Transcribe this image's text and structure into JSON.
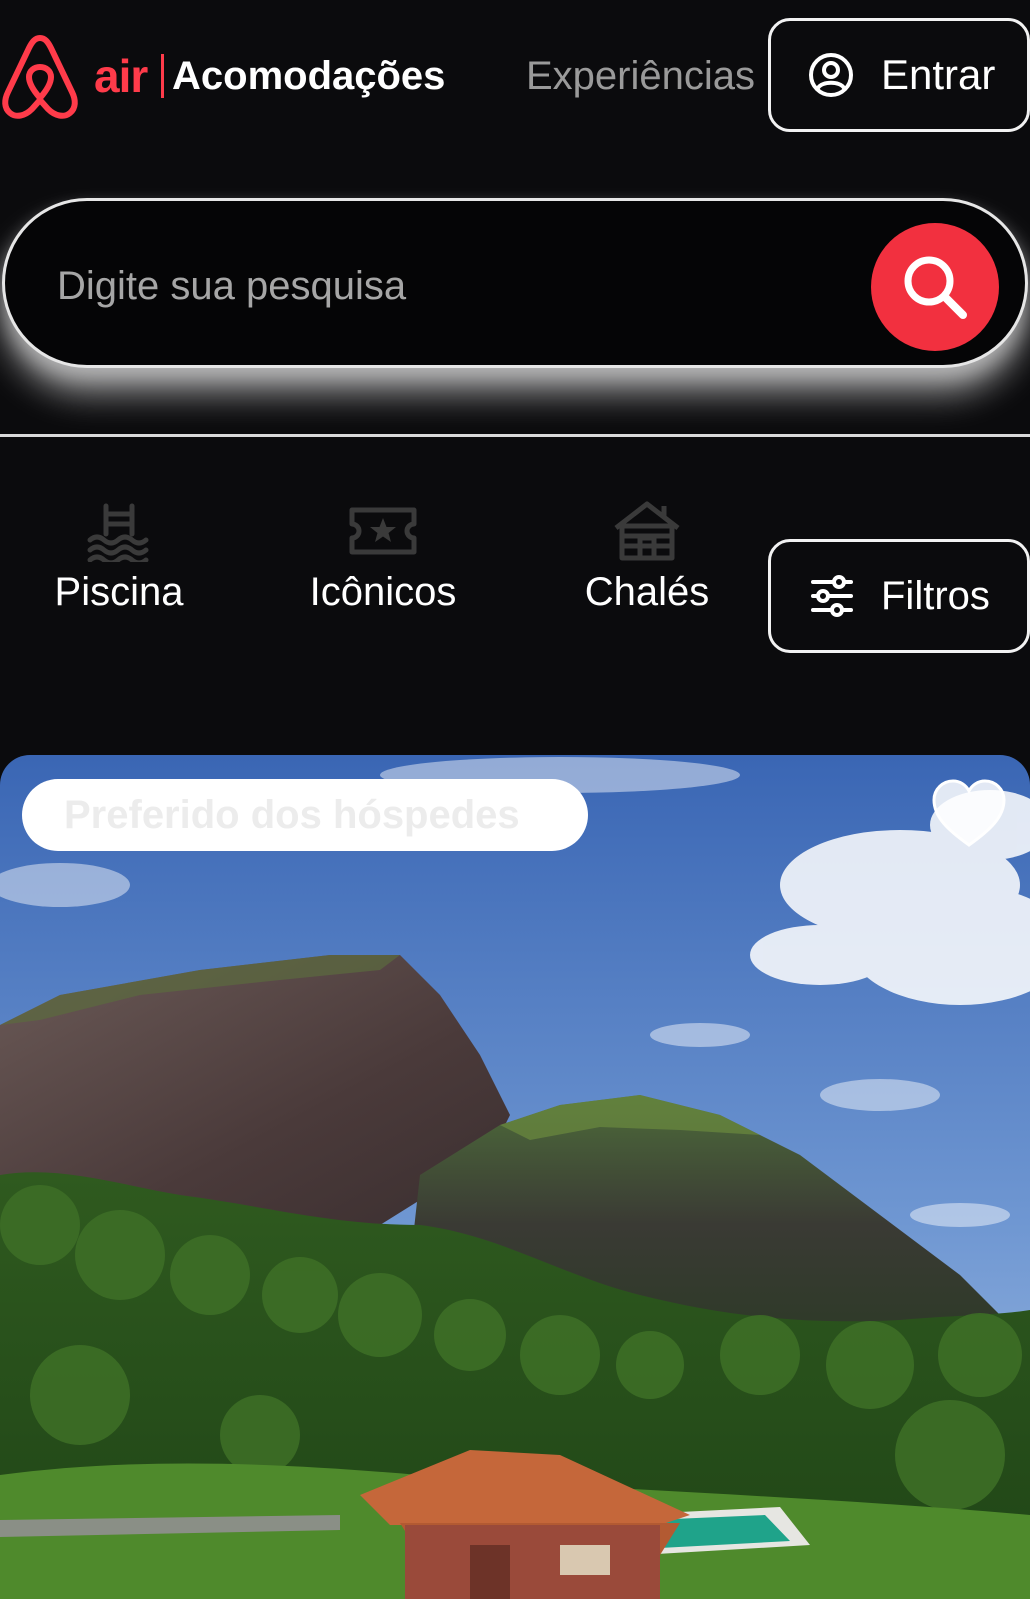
{
  "brand": {
    "logo_text": "air",
    "accent_color": "#ff3b4a",
    "logo_icon": "airbnb-belo-icon"
  },
  "nav": {
    "accommodations": "Acomodações",
    "experiences": "Experiências",
    "login_label": "Entrar",
    "login_icon": "user-circle-icon"
  },
  "search": {
    "placeholder": "Digite sua pesquisa",
    "value": "",
    "button_icon": "search-icon",
    "button_color": "#f2303f"
  },
  "categories": [
    {
      "label": "Piscina",
      "icon": "pool-icon"
    },
    {
      "label": "Icônicos",
      "icon": "star-ticket-icon"
    },
    {
      "label": "Chalés",
      "icon": "cabin-icon"
    }
  ],
  "filters": {
    "label": "Filtros",
    "icon": "sliders-icon"
  },
  "listing": {
    "badge": "Preferido dos hóspedes",
    "favorite_icon": "heart-icon"
  }
}
